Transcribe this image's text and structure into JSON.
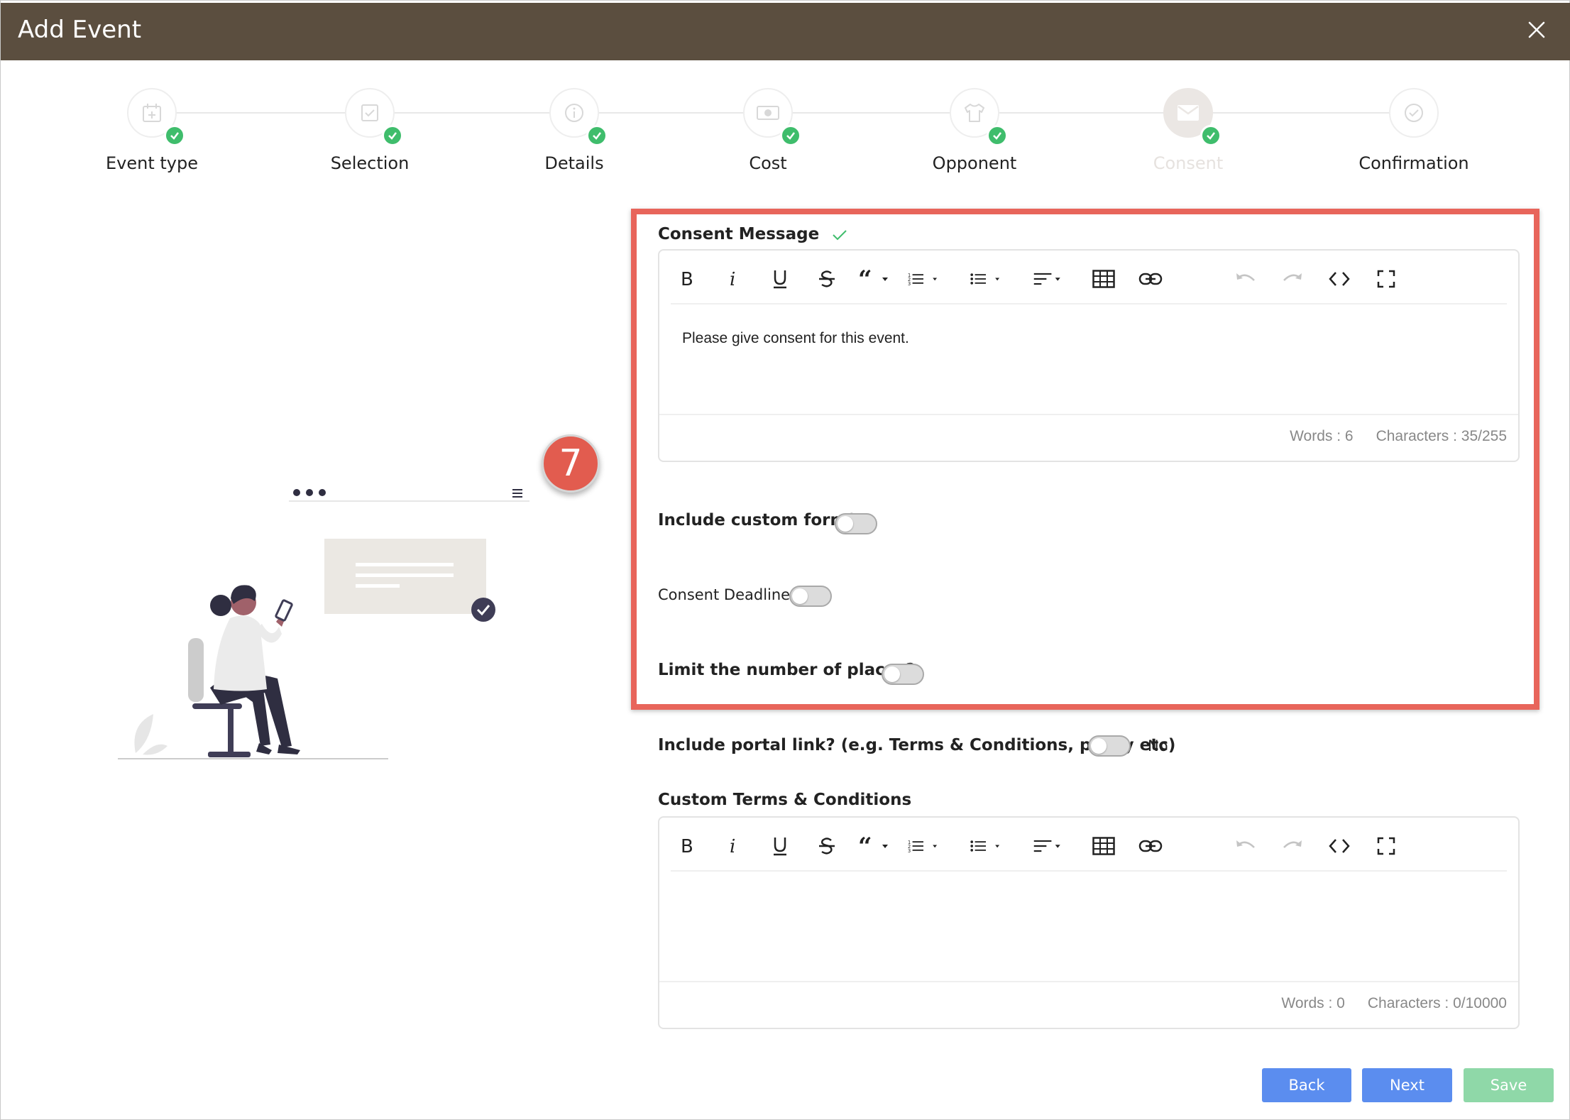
{
  "modal": {
    "title": "Add Event"
  },
  "steps": [
    {
      "label": "Event type",
      "icon": "calendar-plus-icon"
    },
    {
      "label": "Selection",
      "icon": "checkbox-icon"
    },
    {
      "label": "Details",
      "icon": "info-icon"
    },
    {
      "label": "Cost",
      "icon": "money-icon"
    },
    {
      "label": "Opponent",
      "icon": "shirt-icon"
    },
    {
      "label": "Consent",
      "icon": "envelope-icon"
    },
    {
      "label": "Confirmation",
      "icon": "check-circle-icon"
    }
  ],
  "step_badge": "7",
  "consent": {
    "label": "Consent Message",
    "text": "Please give consent for this event.",
    "words": "Words : 6",
    "characters": "Characters : 35/255"
  },
  "toggles": {
    "custom_form": "Include custom form?",
    "deadline": "Consent Deadline",
    "limit_places": "Limit the number of places?",
    "portal_link": "Include portal link? (e.g. Terms & Conditions, policy etc)",
    "portal_link_value": "No"
  },
  "terms": {
    "label": "Custom Terms & Conditions",
    "text": "",
    "words": "Words : 0",
    "characters": "Characters : 0/10000"
  },
  "buttons": {
    "back": "Back",
    "next": "Next",
    "save": "Save"
  },
  "colors": {
    "titlebar": "#5b4e3f",
    "highlight": "#e8655b",
    "step_done": "#3fbd6c",
    "primary_button": "#5b8def",
    "save_button": "#8fd8a8"
  }
}
